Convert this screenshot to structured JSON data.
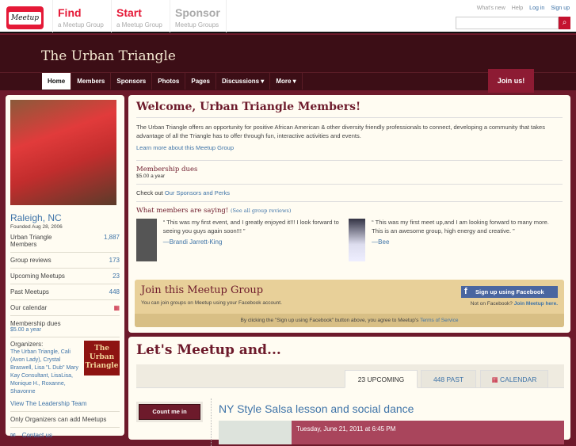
{
  "topbar": {
    "logo": "Meetup",
    "nav": [
      {
        "title": "Find",
        "sub": "a Meetup Group"
      },
      {
        "title": "Start",
        "sub": "a Meetup Group"
      },
      {
        "title": "Sponsor",
        "sub": "Meetup Groups"
      }
    ],
    "links": [
      "What's new",
      "Help",
      "Log in",
      "Sign up"
    ],
    "search_placeholder": ""
  },
  "header": {
    "title": "The Urban Triangle",
    "nav": [
      "Home",
      "Members",
      "Sponsors",
      "Photos",
      "Pages",
      "Discussions ▾",
      "More ▾"
    ],
    "join": "Join us!"
  },
  "sidebar": {
    "city": "Raleigh, NC",
    "founded": "Founded Aug 28, 2006",
    "stats": [
      {
        "label": "Urban Triangle Members",
        "value": "1,887"
      },
      {
        "label": "Group reviews",
        "value": "173"
      },
      {
        "label": "Upcoming Meetups",
        "value": "23"
      },
      {
        "label": "Past Meetups",
        "value": "448"
      }
    ],
    "calendar": "Our calendar",
    "dues_label": "Membership dues",
    "dues_value": "$5.00 a year",
    "organizers_label": "Organizers:",
    "organizers": "The Urban Triangle, Cali (Avon Lady), Crystal Braswell, Lisa \"L Dub\" Mary Kay Consultant, LisaLisa, Monique H., Roxanne, Shavonne",
    "org_logo": "The Urban Triangle",
    "leadership": "View The Leadership Team",
    "only_org": "Only Organizers can add Meetups",
    "contact": "Contact us"
  },
  "main": {
    "welcome": "Welcome, Urban Triangle Members!",
    "description": "The Urban Triangle offers an opportunity for positive African American & other diversity friendly professionals to connect, developing a community that takes advantage of all the Triangle has to offer through fun, interactive activities and events.",
    "learn_more": "Learn more about this Meetup Group",
    "dues_title": "Membership dues",
    "dues_value": "$5.00 a year",
    "check_out": "Check out ",
    "sponsors_link": "Our Sponsors and Perks",
    "saying": "What members are saying!",
    "see_all": "(See all group reviews)",
    "reviews": [
      {
        "quote": "“ This was my first event, and I greatly enjoyed it!!! I look forward to seeing you guys again soon!!! ”",
        "author": "—Brandi Jarrett-King"
      },
      {
        "quote": "“ This was my first meet up,and I am looking forward to many more. This is an awesome group, high energy and creative. ”",
        "author": "—Bee"
      }
    ],
    "join": {
      "title": "Join this Meetup Group",
      "sub": "You can join groups on Meetup using your Facebook account.",
      "fb": "Sign up using Facebook",
      "not_fb": "Not on Facebook?",
      "join_here": "Join Meetup here.",
      "agree": "By clicking the \"Sign up using Facebook\" button above, you agree to Meetup's ",
      "tos": "Terms of Service"
    }
  },
  "meetups": {
    "title": "Let's Meetup and...",
    "tabs": [
      "23 UPCOMING",
      "448 PAST",
      "CALENDAR"
    ],
    "count_me_in": "Count me in",
    "event_title": "NY Style Salsa lesson and social dance",
    "event_date": "Tuesday, June 21, 2011 at 6:45 PM"
  }
}
